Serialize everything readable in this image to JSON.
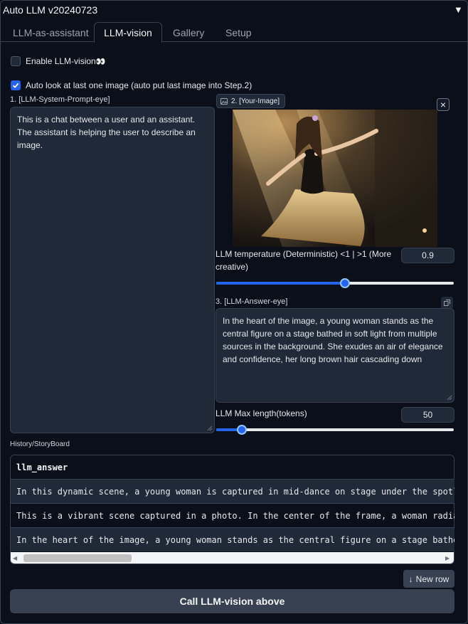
{
  "app": {
    "title": "Auto LLM v20240723",
    "collapse_glyph": "▼"
  },
  "tabs": [
    "LLM-as-assistant",
    "LLM-vision",
    "Gallery",
    "Setup"
  ],
  "enable_vision": {
    "label": "Enable LLM-vision",
    "emoji": "👀",
    "checked": false
  },
  "auto_look": {
    "label": "Auto look at last one image (auto put last image into Step.2)",
    "checked": true
  },
  "system_prompt": {
    "label": "1. [LLM-System-Prompt-eye]",
    "value": "This is a chat between a user and an assistant. The assistant is helping the user to describe an image."
  },
  "image": {
    "label": "2. [Your-Image]",
    "close": "×"
  },
  "temperature": {
    "label": "LLM temperature (Deterministic) <1 | >1 (More creative)",
    "value": "0.9",
    "fraction": 0.45
  },
  "answer": {
    "label": "3. [LLM-Answer-eye]",
    "value": "In the heart of the image, a young woman stands as the central figure on a stage bathed in soft light from multiple sources in the background. She exudes an air of elegance and confidence, her long brown hair cascading down"
  },
  "max_length": {
    "label": "LLM Max length(tokens)",
    "value": "50",
    "fraction": 0.1
  },
  "history": {
    "label": "History/StoryBoard",
    "header": "llm_answer",
    "rows": [
      "In this dynamic scene, a young woman is captured in mid-dance on stage under the spotlight",
      "This is a vibrant scene captured in a photo. In the center of the frame, a woman radiates",
      "In the heart of the image, a young woman stands as the central figure on a stage bathed in"
    ]
  },
  "new_row": "New row",
  "call_button": "Call LLM-vision above",
  "colors": {
    "accent": "#2563eb",
    "background": "#0b0f19",
    "surface": "#1f2937"
  }
}
